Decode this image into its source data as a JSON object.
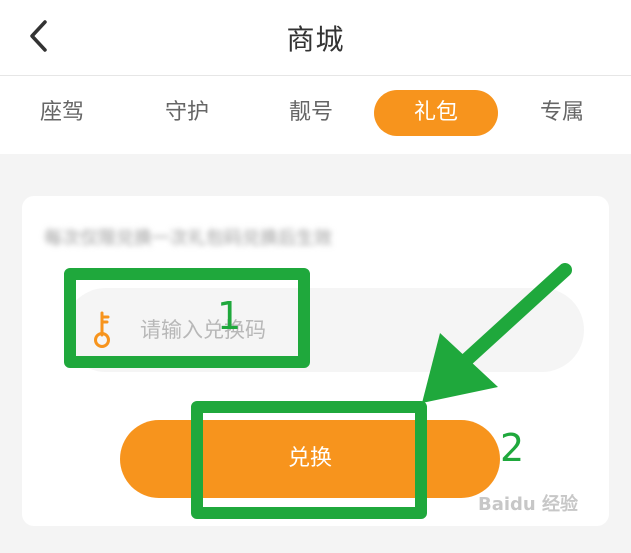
{
  "header": {
    "title": "商城",
    "back_icon": "chevron-left-icon"
  },
  "tabs": [
    {
      "label": "座驾",
      "active": false
    },
    {
      "label": "守护",
      "active": false
    },
    {
      "label": "靓号",
      "active": false
    },
    {
      "label": "礼包",
      "active": true
    },
    {
      "label": "专属",
      "active": false
    }
  ],
  "redeem_card": {
    "blurred_description": "每次仅限兑换一次礼包码兑换后生效",
    "code_input": {
      "placeholder": "请输入兑换码",
      "value": "",
      "icon": "key-icon"
    },
    "redeem_button_label": "兑换"
  },
  "annotations": {
    "label_1": "1",
    "label_2": "2",
    "color": "#1fa83c"
  },
  "watermark": "Baidu 经验",
  "colors": {
    "accent": "#f7941d",
    "background": "#f4f4f4",
    "annotation": "#1fa83c"
  }
}
